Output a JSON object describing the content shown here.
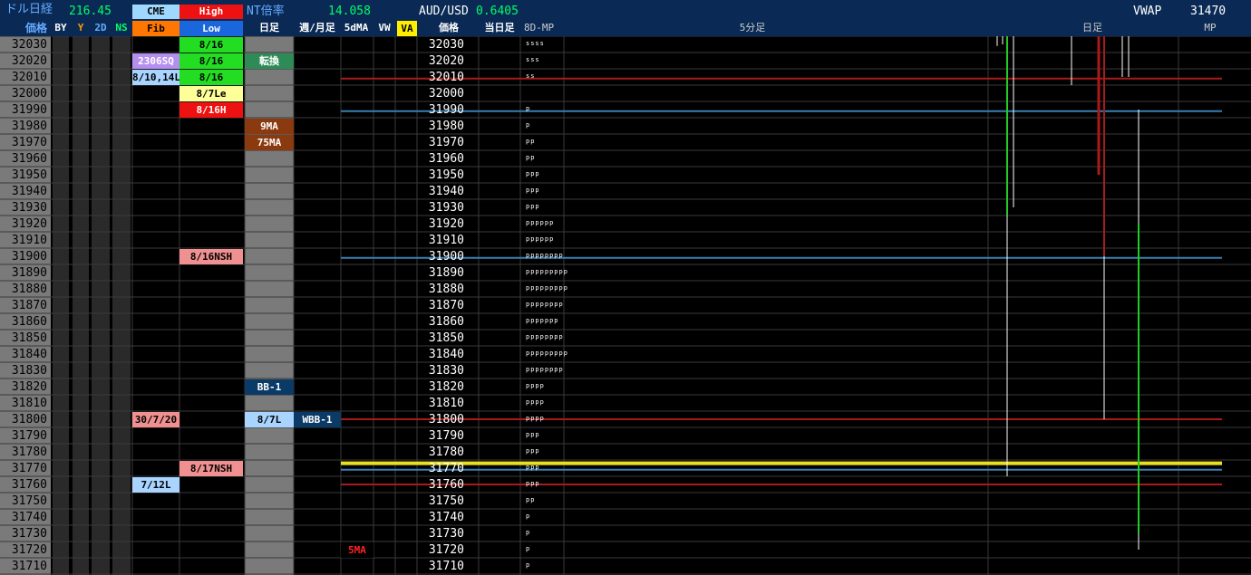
{
  "header": {
    "title": "ドル日経",
    "title_value": "216.45",
    "cme_label": "CME",
    "high_label": "High",
    "nt_label": "NT倍率",
    "nt_value": "14.058",
    "aud_label": "AUD/USD",
    "aud_value": "0.6405",
    "vwap_label": "VWAP",
    "vwap_value": "31470",
    "left_col_header": "価格",
    "sub": [
      "BY",
      "Y",
      "2D",
      "NS"
    ],
    "fib_label": "Fib",
    "low_label": "Low",
    "daily_label": "日足",
    "weekly_label": "週/月足",
    "ma5_label": "5dMA",
    "vw_label": "VW",
    "va_label": "VA",
    "price_label": "価格",
    "today_label": "当日足",
    "mp_label": "8D-MP",
    "min5_label": "5分足",
    "daily2_label": "日足",
    "mp2_label": "MP"
  },
  "prices": [
    "32030",
    "32020",
    "32010",
    "32000",
    "31990",
    "31980",
    "31970",
    "31960",
    "31950",
    "31940",
    "31930",
    "31920",
    "31910",
    "31900",
    "31890",
    "31880",
    "31870",
    "31860",
    "31850",
    "31840",
    "31830",
    "31820",
    "31810",
    "31800",
    "31790",
    "31780",
    "31770",
    "31760",
    "31750",
    "31740",
    "31730",
    "31720",
    "31710"
  ],
  "tpo": [
    "ssss",
    "sss",
    "ss",
    "",
    "p",
    "p",
    "pp",
    "pp",
    "ppp",
    "ppp",
    "ppp",
    "pppppp",
    "pppppp",
    "pppppppp",
    "ppppppppp",
    "ppppppppp",
    "pppppppp",
    "ppppppp",
    "pppppppp",
    "ppppppppp",
    "pppppppp",
    "pppp",
    "pppp",
    "pppp",
    "ppp",
    "ppp",
    "ppp",
    "ppp",
    "pp",
    "p",
    "p",
    "p",
    "p"
  ],
  "labels": [
    {
      "row": 1,
      "col": "fib",
      "text": "2306SQ",
      "bg": "#b58ff0",
      "fg": "#ffffff"
    },
    {
      "row": 2,
      "col": "fib",
      "text": "8/10,14L",
      "bg": "#a9d4ff",
      "fg": "#000000"
    },
    {
      "row": 23,
      "col": "fib",
      "text": "30/7/20",
      "bg": "#f09090",
      "fg": "#000000"
    },
    {
      "row": 27,
      "col": "fib",
      "text": "7/12L",
      "bg": "#a9d4ff",
      "fg": "#000000"
    },
    {
      "row": 0,
      "col": "hl",
      "text": "8/16",
      "bg": "#22dd22",
      "fg": "#000000"
    },
    {
      "row": 1,
      "col": "hl",
      "text": "8/16",
      "bg": "#22dd22",
      "fg": "#000000"
    },
    {
      "row": 2,
      "col": "hl",
      "text": "8/16",
      "bg": "#22dd22",
      "fg": "#000000"
    },
    {
      "row": 3,
      "col": "hl",
      "text": "8/7Le",
      "bg": "#ffff99",
      "fg": "#000000"
    },
    {
      "row": 4,
      "col": "hl",
      "text": "8/16H",
      "bg": "#ee1111",
      "fg": "#ffffff"
    },
    {
      "row": 13,
      "col": "hl",
      "text": "8/16NSH",
      "bg": "#f09090",
      "fg": "#000000"
    },
    {
      "row": 26,
      "col": "hl",
      "text": "8/17NSH",
      "bg": "#f09090",
      "fg": "#000000"
    },
    {
      "row": 1,
      "col": "daily",
      "text": "転換",
      "bg": "#2e8b57",
      "fg": "#ffffff"
    },
    {
      "row": 5,
      "col": "daily",
      "text": "9MA",
      "bg": "#8b3a10",
      "fg": "#ffffff"
    },
    {
      "row": 6,
      "col": "daily",
      "text": "75MA",
      "bg": "#8b3a10",
      "fg": "#ffffff"
    },
    {
      "row": 21,
      "col": "daily",
      "text": "BB-1",
      "bg": "#0a3a66",
      "fg": "#ffffff"
    },
    {
      "row": 23,
      "col": "daily",
      "text": "8/7L",
      "bg": "#a9d4ff",
      "fg": "#000000"
    },
    {
      "row": 23,
      "col": "weekly",
      "text": "WBB-1",
      "bg": "#0a3a66",
      "fg": "#ffffff"
    },
    {
      "row": 31,
      "col": "ma5",
      "text": "5MA",
      "bg": "#000000",
      "fg": "#ff2222"
    }
  ],
  "hlines": [
    {
      "row": 2.6,
      "color": "#aa1a1a",
      "width": 2
    },
    {
      "row": 4.6,
      "color": "#3a7fb0",
      "width": 2
    },
    {
      "row": 13.6,
      "color": "#3a7fb0",
      "width": 2
    },
    {
      "row": 23.5,
      "color": "#aa1a1a",
      "width": 2
    },
    {
      "row": 26.2,
      "color": "#e8e020",
      "width": 4
    },
    {
      "row": 26.6,
      "color": "#3a7fb0",
      "width": 2
    },
    {
      "row": 27.5,
      "color": "#aa1a1a",
      "width": 2
    }
  ],
  "colors": {
    "header_bg": "#0a2a55",
    "col_gray": "#7a7a7a",
    "col_dark": "#2a2a2a",
    "grid": "#3a3a3a"
  }
}
